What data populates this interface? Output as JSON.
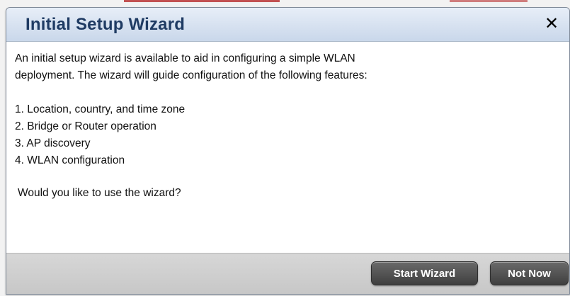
{
  "dialog": {
    "title": "Initial Setup Wizard",
    "close_glyph": "✕",
    "body": {
      "line_1": "An initial setup wizard is available to aid in configuring a simple WLAN",
      "line_2": "deployment.  The wizard will guide configuration of the following features:",
      "features": [
        "1. Location, country, and time zone",
        "2. Bridge or Router operation",
        "3. AP discovery",
        "4. WLAN configuration"
      ],
      "question": "Would you like to use the wizard?"
    },
    "buttons": {
      "start_label": "Start Wizard",
      "not_now_label": "Not Now"
    }
  },
  "colors": {
    "header_title": "#1f3b63",
    "button_dark": "#4a4a4a",
    "accent_red": "#b21b1b"
  },
  "icons": {
    "close": "close-icon"
  }
}
